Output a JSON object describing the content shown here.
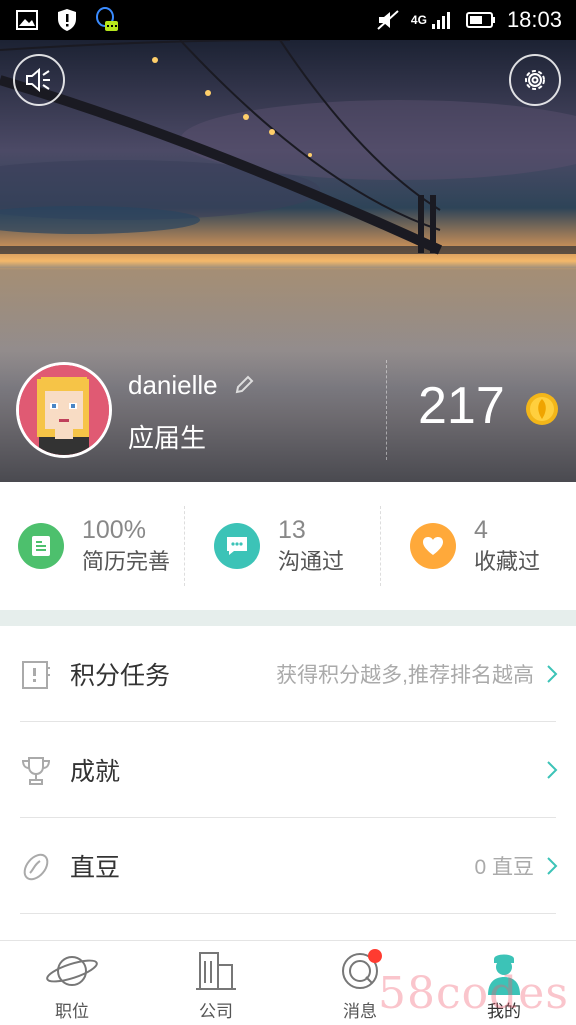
{
  "status_bar": {
    "network": "4G",
    "time": "18:03"
  },
  "profile": {
    "username": "danielle",
    "status": "应届生",
    "points": "217"
  },
  "stats": [
    {
      "value": "100%",
      "label": "简历完善",
      "icon": "resume-icon",
      "color": "#4dc06d"
    },
    {
      "value": "13",
      "label": "沟通过",
      "icon": "chat-icon",
      "color": "#3cc3b7"
    },
    {
      "value": "4",
      "label": "收藏过",
      "icon": "heart-icon",
      "color": "#ffa93a"
    }
  ],
  "menu": [
    {
      "label": "积分任务",
      "hint": "获得积分越多,推荐排名越高",
      "icon": "task-icon"
    },
    {
      "label": "成就",
      "hint": "",
      "icon": "trophy-icon"
    },
    {
      "label": "直豆",
      "hint": "0 直豆",
      "icon": "bean-icon"
    }
  ],
  "nav": [
    {
      "label": "职位",
      "icon": "planet-icon"
    },
    {
      "label": "公司",
      "icon": "building-icon"
    },
    {
      "label": "消息",
      "icon": "message-icon"
    },
    {
      "label": "我的",
      "icon": "user-icon"
    }
  ],
  "watermark": "58codes",
  "colors": {
    "accent": "#3cc3b7",
    "badge": "#ff3b30",
    "divider": "#e6eeec"
  }
}
